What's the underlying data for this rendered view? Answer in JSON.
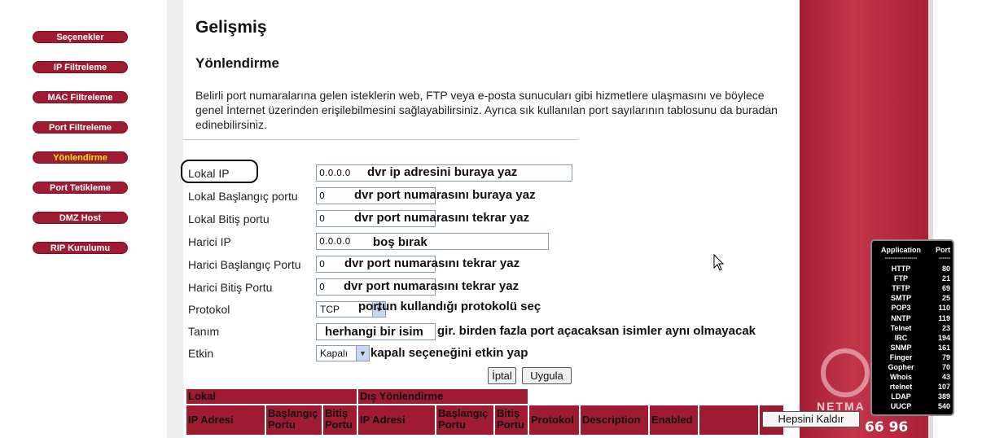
{
  "sidebar": {
    "items": [
      {
        "label": "Seçenekler"
      },
      {
        "label": "IP Filtreleme"
      },
      {
        "label": "MAC Filtreleme"
      },
      {
        "label": "Port Filtreleme"
      },
      {
        "label": "Yönlendirme",
        "active": true
      },
      {
        "label": "Port Tetikleme"
      },
      {
        "label": "DMZ Host"
      },
      {
        "label": "RIP Kurulumu"
      }
    ]
  },
  "page": {
    "title": "Gelişmiş",
    "section": "Yönlendirme",
    "description": "Belirli port numaralarına gelen isteklerin web, FTP veya e-posta sunucuları gibi hizmetlere ulaşmasını ve böylece genel İnternet üzerinden erişilebilmesini sağlayabilirsiniz. Ayrıca sık kullanılan port sayılarının tablosunu da buradan edinebilirsiniz."
  },
  "form": {
    "local_ip": {
      "label": "Lokal IP",
      "value": "0.0.0.0",
      "note": "dvr ip adresini buraya yaz"
    },
    "local_start_port": {
      "label": "Lokal Başlangıç portu",
      "value": "0",
      "note": "dvr port numarasını buraya yaz"
    },
    "local_end_port": {
      "label": "Lokal Bitiş portu",
      "value": "0",
      "note": "dvr port numarasını tekrar yaz"
    },
    "external_ip": {
      "label": "Harici IP",
      "value": "0.0.0.0",
      "note": "boş bırak"
    },
    "external_start_port": {
      "label": "Harici Başlangıç Portu",
      "value": "0",
      "note": "dvr port numarasını tekrar yaz"
    },
    "external_end_port": {
      "label": "Harici Bitiş Portu",
      "value": "0",
      "note": "dvr port numarasını tekrar yaz"
    },
    "protocol": {
      "label": "Protokol",
      "value": "TCP",
      "note": "portun kullandığı protokolü seç"
    },
    "description": {
      "label": "Tanım",
      "value": "herhangi bir isim",
      "note": "gir. birden fazla port açacaksan isimler aynı olmayacak"
    },
    "enabled": {
      "label": "Etkin",
      "value": "Kapalı",
      "note": "kapalı seçeneğini etkin yap"
    },
    "cancel_button": "İptal",
    "apply_button": "Uygula"
  },
  "table": {
    "group_local": "Lokal",
    "group_external": "Dış Yönlendirme",
    "columns": [
      "IP Adresi",
      "Başlangıç Portu",
      "Bitiş Portu",
      "IP Adresi",
      "Başlangıç Portu",
      "Bitiş Portu",
      "Protokol",
      "Description",
      "Enabled"
    ],
    "remove_all_button": "Hepsini Kaldır"
  },
  "port_reference": {
    "header_app": "Application",
    "header_port": "Port",
    "separator_app": "-----------------",
    "separator_port": "------",
    "rows": [
      {
        "app": "HTTP",
        "port": "80"
      },
      {
        "app": "FTP",
        "port": "21"
      },
      {
        "app": "TFTP",
        "port": "69"
      },
      {
        "app": "SMTP",
        "port": "25"
      },
      {
        "app": "POP3",
        "port": "110"
      },
      {
        "app": "NNTP",
        "port": "119"
      },
      {
        "app": "Telnet",
        "port": "23"
      },
      {
        "app": "IRC",
        "port": "194"
      },
      {
        "app": "SNMP",
        "port": "161"
      },
      {
        "app": "Finger",
        "port": "79"
      },
      {
        "app": "Gopher",
        "port": "70"
      },
      {
        "app": "Whois",
        "port": "43"
      },
      {
        "app": "rtelnet",
        "port": "107"
      },
      {
        "app": "LDAP",
        "port": "389"
      },
      {
        "app": "UUCP",
        "port": "540"
      }
    ]
  },
  "brand": {
    "partial_text": "NETMA",
    "number_text": "66 96"
  },
  "colors": {
    "accent": "#9e1b32",
    "active_nav_text": "#ffe600"
  }
}
